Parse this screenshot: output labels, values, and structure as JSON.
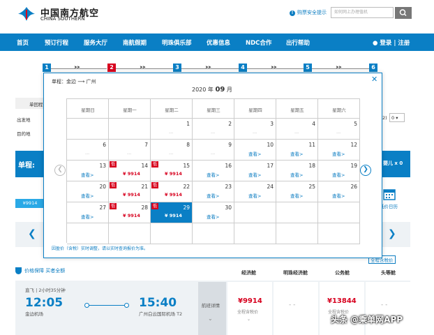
{
  "header": {
    "logo_cn": "中国南方航空",
    "logo_en": "CHINA SOUTHERN",
    "safety_tip": "购票安全提示",
    "search_placeholder": "如何网上办理值机"
  },
  "nav": {
    "items": [
      "首页",
      "预订行程",
      "服务大厅",
      "南航假期",
      "明珠俱乐部",
      "优惠信息",
      "NDC合作",
      "出行帮助"
    ],
    "login": "登录 | 注册"
  },
  "steps": [
    "1",
    "2",
    "3",
    "4",
    "5",
    "6"
  ],
  "background": {
    "tab_label": "单回程",
    "from_label": "出发地",
    "to_label": "目的地",
    "single_label": "单程:",
    "infant_label": "婴儿 x 0",
    "price_chip": "¥9914",
    "low_price_calendar": "低价日历",
    "select_value": "0",
    "select_prefix": "2)",
    "tax_link": "全程含税价"
  },
  "modal": {
    "route_prefix": "单程：",
    "route_from": "金边",
    "route_arrow": "⟶",
    "route_to": "广州",
    "year_text": "2020 年",
    "month": "09",
    "month_suffix": "月",
    "weekdays": [
      "星期日",
      "星期一",
      "星期二",
      "星期三",
      "星期四",
      "星期五",
      "星期六"
    ],
    "note": "因盈价（含税）实时调整，请以实时查询报价为准。",
    "low_badge": "低",
    "view_text": "查看>"
  },
  "calendar_rows": [
    [
      {
        "d": "",
        "t": ""
      },
      {
        "d": "",
        "t": ""
      },
      {
        "d": "1",
        "t": "..."
      },
      {
        "d": "2",
        "t": "..."
      },
      {
        "d": "3",
        "t": "..."
      },
      {
        "d": "4",
        "t": "..."
      },
      {
        "d": "5",
        "t": "..."
      }
    ],
    [
      {
        "d": "6",
        "t": "..."
      },
      {
        "d": "7",
        "t": "..."
      },
      {
        "d": "8",
        "t": "..."
      },
      {
        "d": "9",
        "t": "..."
      },
      {
        "d": "10",
        "t": "查看>"
      },
      {
        "d": "11",
        "t": "查看>"
      },
      {
        "d": "12",
        "t": "查看>"
      }
    ],
    [
      {
        "d": "13",
        "t": "查看>"
      },
      {
        "d": "14",
        "t": "¥ 9914",
        "low": true
      },
      {
        "d": "15",
        "t": "¥ 9914",
        "low": true
      },
      {
        "d": "16",
        "t": "查看>"
      },
      {
        "d": "17",
        "t": "查看>"
      },
      {
        "d": "18",
        "t": "查看>"
      },
      {
        "d": "19",
        "t": "查看>"
      }
    ],
    [
      {
        "d": "20",
        "t": "查看>"
      },
      {
        "d": "21",
        "t": "¥ 9914",
        "low": true
      },
      {
        "d": "22",
        "t": "¥ 9914",
        "low": true
      },
      {
        "d": "23",
        "t": "查看>"
      },
      {
        "d": "24",
        "t": "查看>"
      },
      {
        "d": "25",
        "t": "查看>"
      },
      {
        "d": "26",
        "t": "查看>"
      }
    ],
    [
      {
        "d": "27",
        "t": "查看>"
      },
      {
        "d": "28",
        "t": "¥ 9914",
        "low": true
      },
      {
        "d": "29",
        "t": "¥ 9914",
        "low": true,
        "sel": true
      },
      {
        "d": "30",
        "t": "查看>"
      },
      {
        "d": "",
        "t": ""
      },
      {
        "d": "",
        "t": ""
      },
      {
        "d": "",
        "t": ""
      }
    ],
    [
      {
        "d": "",
        "t": ""
      },
      {
        "d": "",
        "t": ""
      },
      {
        "d": "",
        "t": ""
      },
      {
        "d": "",
        "t": ""
      },
      {
        "d": "",
        "t": ""
      },
      {
        "d": "",
        "t": ""
      },
      {
        "d": "",
        "t": ""
      }
    ]
  ],
  "fares": {
    "guarantee": "价格保障 买者全额",
    "classes": [
      "经济舱",
      "明珠经济舱",
      "公务舱",
      "头等舱"
    ],
    "flight_type": "直飞 | 2小时35分钟",
    "dep_time": "12:05",
    "dep_airport": "金边机场",
    "arr_time": "15:40",
    "arr_airport": "广州白云国际机场 T2",
    "detail": "航班详情",
    "economy_price": "¥9914",
    "business_price": "¥13844",
    "tax_note": "全程含税价",
    "dash": "- -"
  },
  "watermark": "头条 @乘单网APP",
  "colors": {
    "brand_blue": "#0a7fc5",
    "low_red": "#d7001e",
    "link_blue": "#0b7cc1"
  }
}
